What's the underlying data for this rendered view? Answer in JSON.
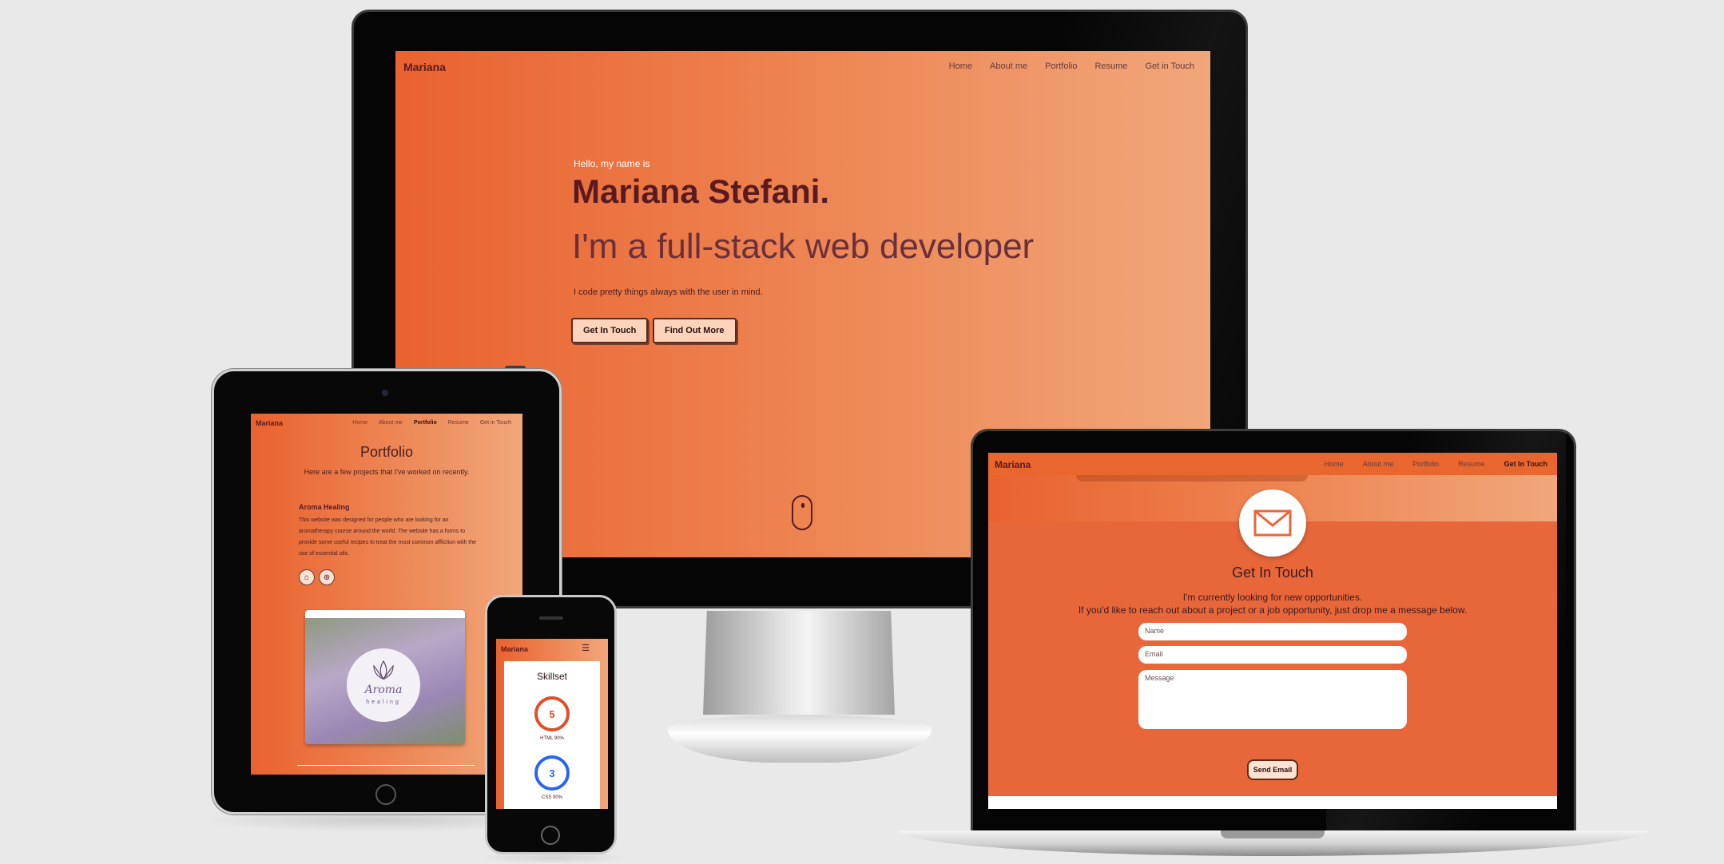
{
  "monitor": {
    "brand": "Mariana",
    "nav": [
      "Home",
      "About me",
      "Portfolio",
      "Resume",
      "Get in Touch"
    ],
    "hello": "Hello, my name is",
    "name": "Mariana Stefani.",
    "title": "I'm a full-stack web developer",
    "description": "I code pretty things always with the user in mind.",
    "buttons": [
      "Get In Touch",
      "Find Out More"
    ]
  },
  "tablet": {
    "brand": "Mariana",
    "nav": [
      "Home",
      "About me",
      "Portfolio",
      "Resume",
      "Get in Touch"
    ],
    "section_title": "Portfolio",
    "section_subtitle": "Here are a few projects that I've worked on recently.",
    "project_title": "Aroma Healing",
    "project_description": "This website was designed for people who are looking for an aromatherapy course around the world. The website has a forms to provide some useful recipes to treat the most common affliction with the use of essential oils.",
    "logo_text": "Aroma",
    "logo_subtext": "healing"
  },
  "phone": {
    "brand": "Mariana",
    "section_title": "Skillset",
    "skills": [
      {
        "icon": "5",
        "label": "HTML 90%",
        "color": "#e44d26"
      },
      {
        "icon": "3",
        "label": "CSS 90%",
        "color": "#2965f1"
      }
    ]
  },
  "laptop": {
    "brand": "Mariana",
    "nav": [
      "Home",
      "About me",
      "Portfolio",
      "Resume",
      "Get In Touch"
    ],
    "section_title": "Get In Touch",
    "line1": "I'm currently looking for new opportunities.",
    "line2": "If you'd like to reach out about a project or a job opportunity, just drop me a message below.",
    "name_placeholder": "Name",
    "email_placeholder": "Email",
    "message_placeholder": "Message",
    "send_label": "Send Email"
  }
}
